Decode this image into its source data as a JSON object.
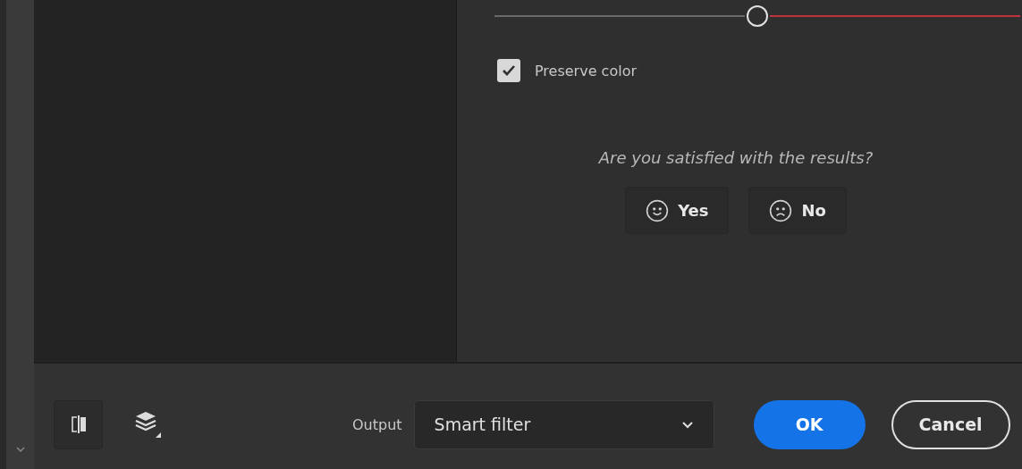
{
  "slider": {
    "level": 0.5
  },
  "preserve_color": {
    "label": "Preserve color",
    "checked": true
  },
  "feedback": {
    "question": "Are you satisfied with the results?",
    "buttons": [
      {
        "label": "Yes",
        "kind": "happy"
      },
      {
        "label": "No",
        "kind": "sad"
      }
    ]
  },
  "footer": {
    "output": {
      "label": "Output",
      "value": "Smart filter"
    },
    "buttons": [
      {
        "label": "OK",
        "kind": "primary"
      },
      {
        "label": "Cancel",
        "kind": "secondary"
      }
    ]
  }
}
